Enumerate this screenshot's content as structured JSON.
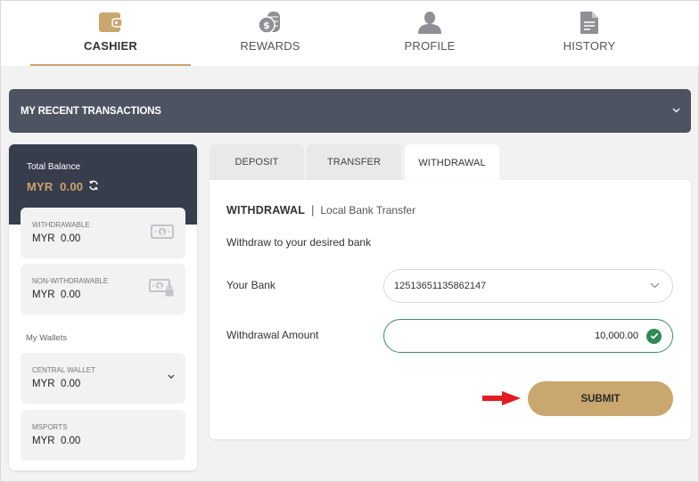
{
  "nav": {
    "items": [
      {
        "label": "CASHIER",
        "icon": "wallet-icon",
        "active": true
      },
      {
        "label": "REWARDS",
        "icon": "coins-icon",
        "active": false
      },
      {
        "label": "PROFILE",
        "icon": "user-icon",
        "active": false
      },
      {
        "label": "HISTORY",
        "icon": "document-icon",
        "active": false
      }
    ]
  },
  "recent_transactions": {
    "title": "MY RECENT TRANSACTIONS",
    "icon": "chevron-down-icon"
  },
  "balance": {
    "total_label": "Total Balance",
    "total_value": "MYR  0.00",
    "refresh_icon": "refresh-icon",
    "cards": [
      {
        "label": "WITHDRAWABLE",
        "value": "MYR  0.00",
        "icon": "cash-icon"
      },
      {
        "label": "NON-WITHDRAWABLE",
        "value": "MYR  0.00",
        "icon": "cash-lock-icon"
      }
    ],
    "wallets_title": "My Wallets",
    "wallets": [
      {
        "label": "CENTRAL WALLET",
        "value": "MYR  0.00",
        "icon": "chevron-down-icon"
      },
      {
        "label": "MSPORTS",
        "value": "MYR  0.00"
      }
    ]
  },
  "tabs": [
    {
      "label": "DEPOSIT",
      "active": false
    },
    {
      "label": "TRANSFER",
      "active": false
    },
    {
      "label": "WITHDRAWAL",
      "active": true
    }
  ],
  "form": {
    "title": "WITHDRAWAL",
    "separator": "|",
    "subtitle": "Local Bank Transfer",
    "description": "Withdraw to your desired bank",
    "bank_label": "Your Bank",
    "bank_value": "12513651135862147",
    "amount_label": "Withdrawal Amount",
    "amount_value": "10,000.00",
    "submit_label": "SUBMIT"
  },
  "colors": {
    "accent_gold": "#c9a76e",
    "dark_header": "#383d4c",
    "bar_gray": "#4e5361",
    "valid_green": "#2f8a55",
    "arrow_red": "#e31b23"
  }
}
